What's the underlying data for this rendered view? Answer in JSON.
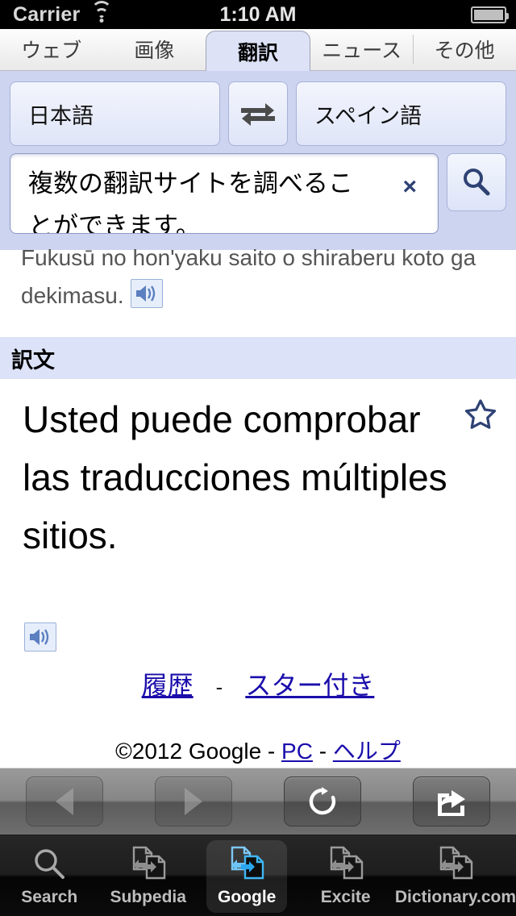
{
  "status_bar": {
    "carrier": "Carrier",
    "time": "1:10 AM",
    "wifi_icon": "wifi-icon",
    "battery_icon": "battery-icon"
  },
  "tabs": [
    {
      "label": "ウェブ",
      "active": false
    },
    {
      "label": "画像",
      "active": false
    },
    {
      "label": "翻訳",
      "active": true
    },
    {
      "label": "ニュース",
      "active": false
    },
    {
      "label": "その他",
      "active": false
    }
  ],
  "language_bar": {
    "source_language": "日本語",
    "target_language": "スペイン語",
    "swap_icon": "swap-arrows-icon"
  },
  "search": {
    "input_value": "複数の翻訳サイトを調べることができます。",
    "clear_icon": "×",
    "search_icon": "search-icon"
  },
  "transliteration": {
    "text": "Fukusū no hon'yaku saito o shiraberu koto ga dekimasu.",
    "speaker_icon": "speaker-icon"
  },
  "result": {
    "section_header": "訳文",
    "translated_text": "Usted puede comprobar las traducciones múltiples sitios.",
    "star_icon": "star-outline-icon",
    "speaker_icon": "speaker-icon"
  },
  "footer": {
    "history_link": "履歴",
    "separator": "-",
    "starred_link": "スター付き",
    "copyright": "©2012 Google - ",
    "pc_link": "PC",
    "copyright_mid": " - ",
    "help_link": "ヘルプ"
  },
  "browser_toolbar": {
    "back_icon": "back-arrow-icon",
    "forward_icon": "forward-arrow-icon",
    "reload_icon": "reload-icon",
    "share_icon": "share-icon"
  },
  "app_tabs": [
    {
      "label": "Search",
      "icon": "magnifier-icon",
      "selected": false
    },
    {
      "label": "Subpedia",
      "icon": "translate-pages-icon",
      "selected": false
    },
    {
      "label": "Google",
      "icon": "translate-pages-icon",
      "selected": true
    },
    {
      "label": "Excite",
      "icon": "translate-pages-icon",
      "selected": false
    },
    {
      "label": "Dictionary.com",
      "icon": "translate-pages-icon",
      "selected": false
    }
  ],
  "colors": {
    "accent_lavender": "#ccd4f0",
    "section_header_bg": "#dce2f8",
    "link_blue": "#1a0dab",
    "icon_navy": "#2e4274",
    "tab_selected_blue": "#3fb6f5"
  }
}
